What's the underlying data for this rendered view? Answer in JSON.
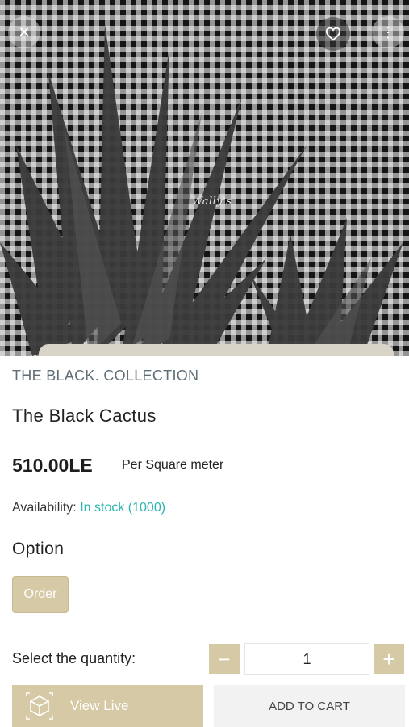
{
  "hero": {
    "brand_mark": "Wally's",
    "back_icon": "close-icon",
    "favorite_icon": "heart-icon",
    "more_icon": "more-icon"
  },
  "product": {
    "collection": "THE BLACK. COLLECTION",
    "title": "The Black Cactus",
    "price": "510.00LE",
    "unit": "Per Square meter",
    "availability_label": "Availability:",
    "availability_status": "In stock",
    "availability_count": "(1000)"
  },
  "options": {
    "heading": "Option",
    "selected": "Order"
  },
  "quantity": {
    "label": "Select the quantity:",
    "minus": "−",
    "plus": "+",
    "value": "1"
  },
  "actions": {
    "view_live": "View Live",
    "add_to_cart": "ADD TO CART"
  },
  "colors": {
    "accent": "#d6c9a6",
    "stock": "#2bb5b0"
  }
}
